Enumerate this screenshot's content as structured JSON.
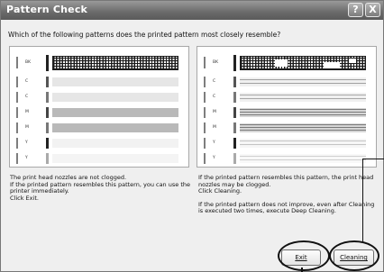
{
  "window": {
    "title": "Pattern Check",
    "help_glyph": "?",
    "close_glyph": "X"
  },
  "question": "Which of the following patterns does the printed pattern most closely resemble?",
  "patterns": {
    "labels": [
      "BK",
      "C",
      "C",
      "M",
      "M",
      "Y",
      "Y"
    ],
    "left_label": "not clogged",
    "right_label": "clogged"
  },
  "left_text": {
    "line1": "The print head nozzles are not clogged.",
    "line2": "If the printed pattern resembles this pattern, you can use the",
    "line3": "printer immediately.",
    "line4": "Click Exit."
  },
  "right_text": {
    "line1": "If the printed pattern resembles this pattern, the print head",
    "line2": "nozzles may be clogged.",
    "line3": "Click Cleaning.",
    "line4": "If the printed pattern does not improve, even after Cleaning",
    "line5": "is executed two times, execute Deep Cleaning."
  },
  "buttons": {
    "exit": "Exit",
    "cleaning": "Cleaning"
  },
  "colors": {
    "titlebar": "#6a6a6a",
    "window_bg": "#efefef",
    "annotation": "#111111"
  }
}
